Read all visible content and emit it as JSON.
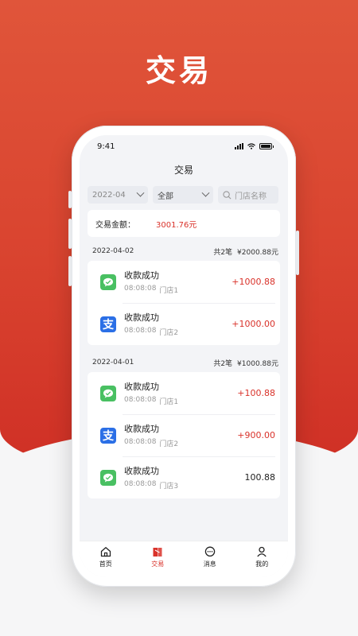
{
  "hero": {
    "title": "交易"
  },
  "status": {
    "time": "9:41"
  },
  "header": {
    "title": "交易"
  },
  "filters": {
    "month": "2022-04",
    "type": "全部",
    "search_placeholder": "门店名称"
  },
  "summary": {
    "label": "交易金额：",
    "value": "3001.76元"
  },
  "groups": [
    {
      "date": "2022-04-02",
      "count": "共2笔",
      "total": "¥2000.88元",
      "items": [
        {
          "method": "wechat",
          "title": "收款成功",
          "time": "08:08:08",
          "store": "门店1",
          "amount": "+1000.88"
        },
        {
          "method": "alipay",
          "title": "收款成功",
          "time": "08:08:08",
          "store": "门店2",
          "amount": "+1000.00"
        }
      ]
    },
    {
      "date": "2022-04-01",
      "count": "共2笔",
      "total": "¥1000.88元",
      "items": [
        {
          "method": "wechat",
          "title": "收款成功",
          "time": "08:08:08",
          "store": "门店1",
          "amount": "+100.88"
        },
        {
          "method": "alipay",
          "title": "收款成功",
          "time": "08:08:08",
          "store": "门店2",
          "amount": "+900.00"
        },
        {
          "method": "wechat",
          "title": "收款成功",
          "time": "08:08:08",
          "store": "门店3",
          "amount": "100.88"
        }
      ]
    }
  ],
  "tabbar": {
    "items": [
      {
        "label": "首页"
      },
      {
        "label": "交易"
      },
      {
        "label": "消息"
      },
      {
        "label": "我的"
      }
    ]
  },
  "icons": {
    "alipay_glyph": "支"
  },
  "colors": {
    "accent": "#d9322a",
    "wechat": "#49c062",
    "alipay": "#2b6fe6"
  }
}
